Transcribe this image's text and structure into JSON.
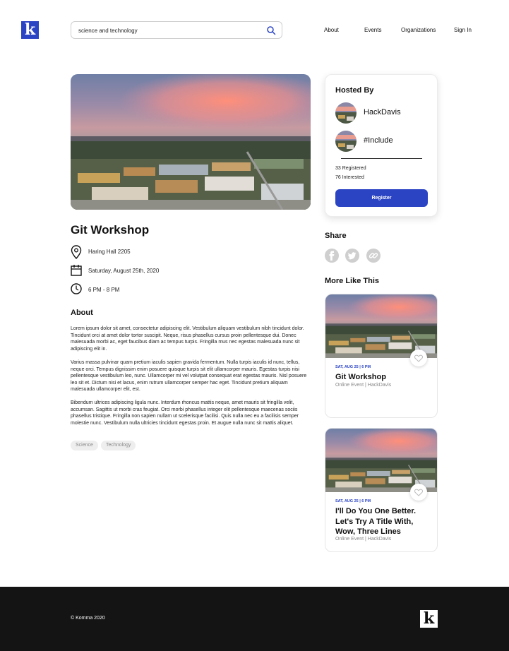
{
  "brand": {
    "logo_letter": "k",
    "accent_color": "#2b44c4"
  },
  "search": {
    "value": "science and technology",
    "icon": "search-icon"
  },
  "nav": {
    "items": [
      "About",
      "Events",
      "Organizations",
      "Sign In"
    ]
  },
  "event": {
    "title": "Git Workshop",
    "location": "Haring Hall 2205",
    "date": "Saturday, August 25th, 2020",
    "time": "6 PM - 8 PM",
    "about_heading": "About",
    "paragraphs": [
      "Lorem ipsum dolor sit amet, consectetur adipiscing elit. Vestibulum aliquam vestibulum nibh tincidunt dolor. Tincidunt orci at amet dolor tortor suscipit. Neque, risus phasellus cursus proin pellentesque dui. Donec malesuada morbi ac, eget faucibus diam ac tempus turpis. Fringilla mus nec egestas malesuada nunc sit adipiscing elit in.",
      "Varius massa pulvinar quam pretium iaculis sapien gravida fermentum. Nulla turpis iaculis id nunc, tellus, neque orci. Tempus dignissim enim posuere quisque turpis sit elit ullamcorper mauris. Egestas turpis nisi pellentesque vestibulum leo, nunc. Ullamcorper mi vel volutpat consequat erat egestas mauris. Nisl posuere leo sit et. Dictum nisi et lacus, enim rutrum ullamcorper semper hac eget. Tincidunt pretium aliquam malesuada ullamcorper elit, est.",
      "Bibendum ultrices adipiscing ligula nunc. Interdum rhoncus mattis neque, amet mauris sit fringilla velit, accumsan. Sagittis ut morbi cras feugiat. Orci morbi phasellus integer elit pellentesque maecenas sociis phasellus tristique. Fringilla non sapien nullam ut scelerisque facilisi. Quis nulla nec eu a facilisis semper molestie nunc. Vestibulum nulla ultricies tincidunt egestas proin. Et augue nulla nunc sit mattis aliquet."
    ],
    "tags": [
      "Science",
      "Technology"
    ]
  },
  "hosted": {
    "heading": "Hosted By",
    "hosts": [
      "HackDavis",
      "#Include"
    ],
    "registered": "33 Registered",
    "interested": "76 Interested",
    "register_label": "Register"
  },
  "share": {
    "heading": "Share",
    "icons": [
      "facebook-icon",
      "twitter-icon",
      "link-icon"
    ]
  },
  "more": {
    "heading": "More Like This",
    "cards": [
      {
        "date": "SAT, AUG 25 | 6 PM",
        "title": "Git Workshop",
        "meta": "Online Event | HackDavis"
      },
      {
        "date": "SAT, AUG 25 | 6 PM",
        "title": "I'll Do You One Better. Let's Try A Title With, Wow, Three Lines",
        "meta": "Online Event | HackDavis"
      }
    ]
  },
  "footer": {
    "copyright": "© Komma 2020",
    "logo_letter": "k"
  }
}
